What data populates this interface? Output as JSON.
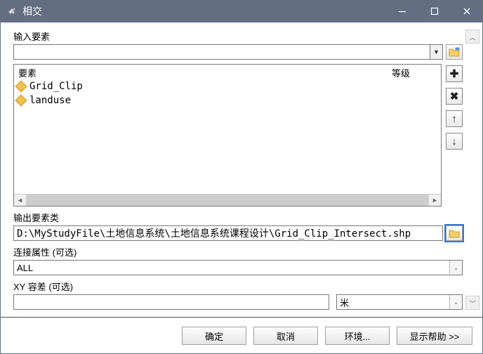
{
  "title": "相交",
  "labels": {
    "input_features": "输入要素",
    "element": "要素",
    "rank": "等级",
    "output_fc": "输出要素类",
    "join_attr": "连接属性 (可选)",
    "xy_tol": "XY 容差 (可选)"
  },
  "features": [
    {
      "name": "Grid_Clip"
    },
    {
      "name": "landuse"
    }
  ],
  "output_path": "D:\\MyStudyFile\\土地信息系统\\土地信息系统课程设计\\Grid_Clip_Intersect.shp",
  "join_value": "ALL",
  "xy_value": "",
  "xy_unit": "米",
  "buttons": {
    "ok": "确定",
    "cancel": "取消",
    "env": "环境...",
    "help": "显示帮助 >>"
  }
}
